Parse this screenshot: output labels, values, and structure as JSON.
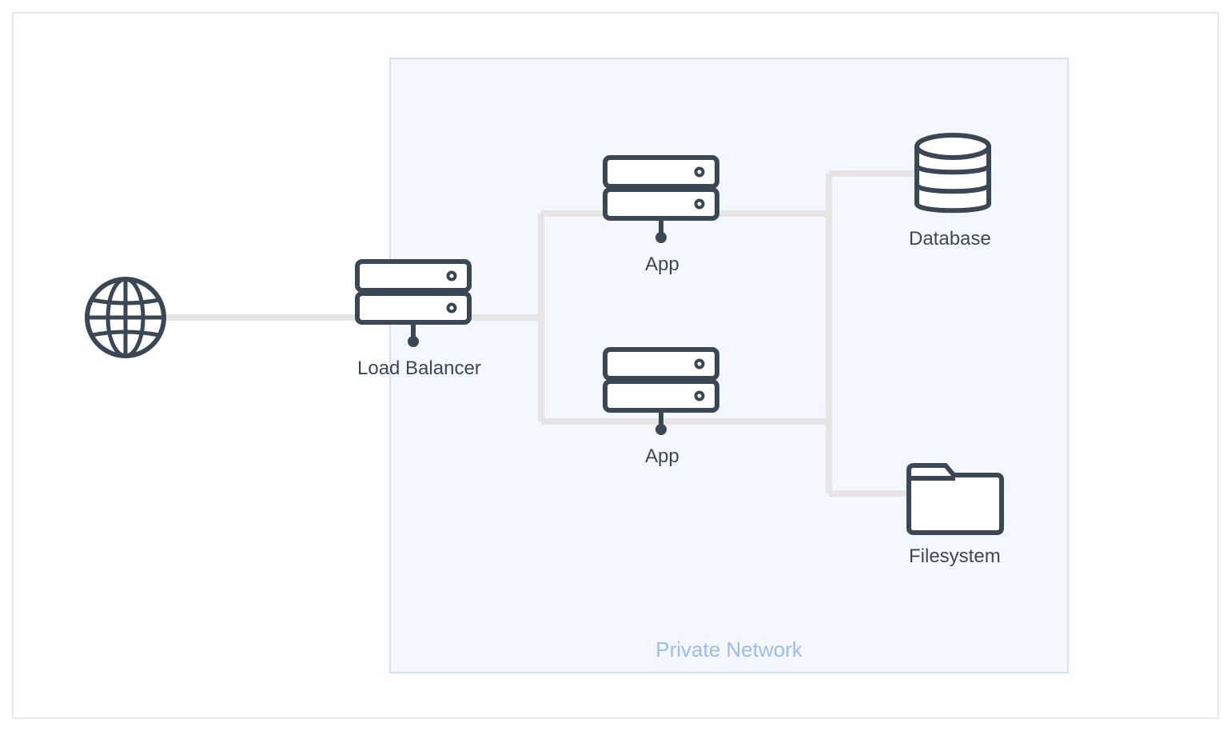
{
  "diagram": {
    "private_network_label": "Private Network",
    "nodes": {
      "internet": {
        "type": "globe"
      },
      "load_balancer": {
        "label": "Load Balancer",
        "type": "server"
      },
      "app1": {
        "label": "App",
        "type": "server"
      },
      "app2": {
        "label": "App",
        "type": "server"
      },
      "database": {
        "label": "Database",
        "type": "database"
      },
      "filesystem": {
        "label": "Filesystem",
        "type": "folder"
      }
    },
    "edges": [
      [
        "internet",
        "load_balancer"
      ],
      [
        "load_balancer",
        "app1"
      ],
      [
        "load_balancer",
        "app2"
      ],
      [
        "app1",
        "database"
      ],
      [
        "app2",
        "database"
      ],
      [
        "app1",
        "filesystem"
      ],
      [
        "app2",
        "filesystem"
      ]
    ],
    "colors": {
      "icon_stroke": "#3c4755",
      "connector": "#e5e5e5",
      "private_bg": "#f4f8fe",
      "private_border": "#d4e2f6",
      "private_text": "#9cbcea"
    }
  }
}
